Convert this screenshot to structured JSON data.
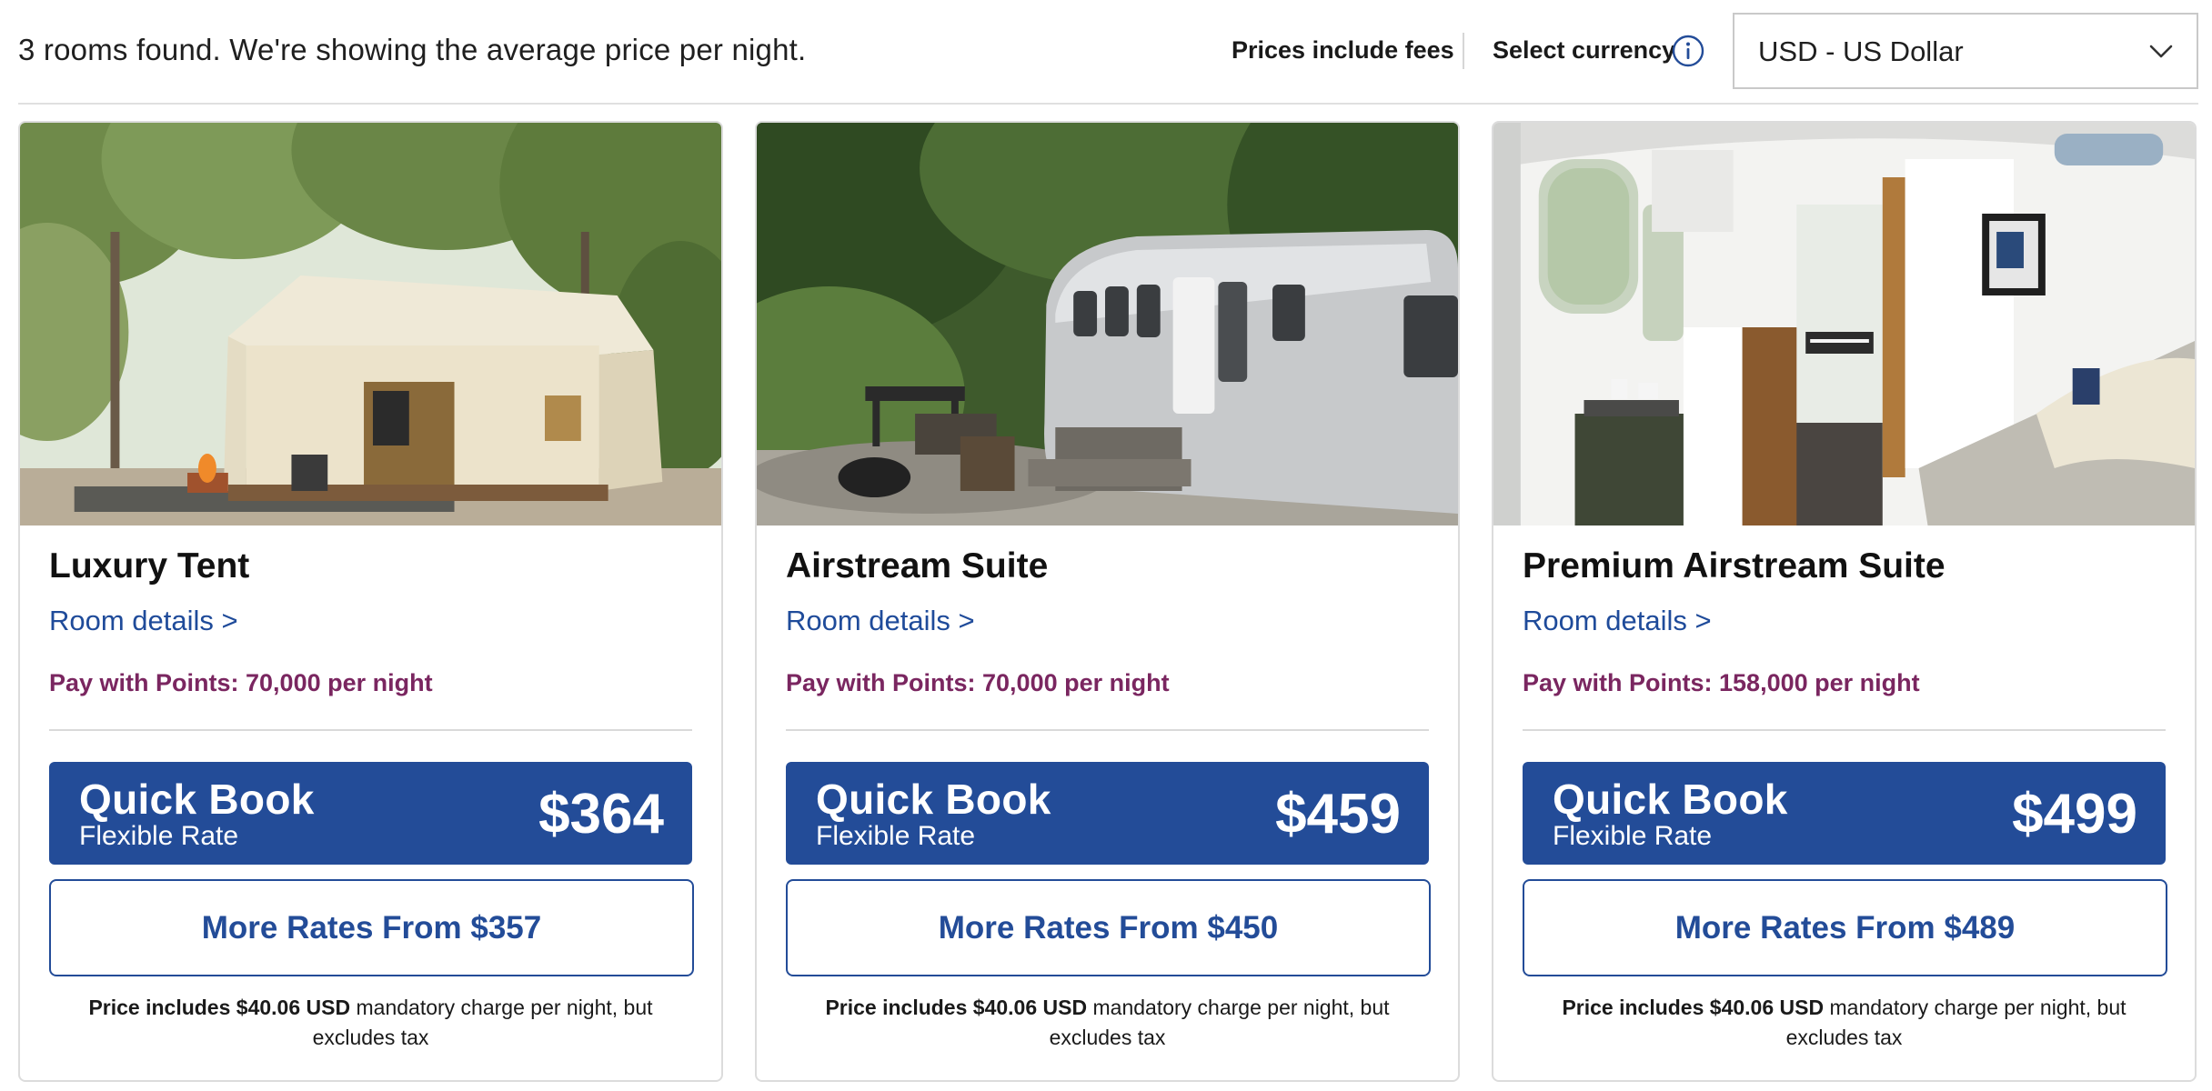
{
  "header": {
    "results_text": "3 rooms found. We're showing the average price per night.",
    "fees_label": "Prices include fees",
    "currency_label": "Select currency",
    "info_icon": "info-icon",
    "currency_value": "USD - US Dollar",
    "dropdown_icon": "chevron-down-icon"
  },
  "rooms": [
    {
      "title": "Luxury Tent",
      "details_link": "Room details >",
      "points": "Pay with Points: 70,000 per night",
      "quickbook_title": "Quick Book",
      "quickbook_sub": "Flexible Rate",
      "quickbook_price": "$364",
      "more_rates": "More Rates From $357",
      "note_prefix": "Price includes",
      "note_amount": "$40.06 USD",
      "note_suffix": "mandatory charge per night, but excludes tax"
    },
    {
      "title": "Airstream Suite",
      "details_link": "Room details >",
      "points": "Pay with Points: 70,000 per night",
      "quickbook_title": "Quick Book",
      "quickbook_sub": "Flexible Rate",
      "quickbook_price": "$459",
      "more_rates": "More Rates From $450",
      "note_prefix": "Price includes",
      "note_amount": "$40.06 USD",
      "note_suffix": "mandatory charge per night, but excludes tax"
    },
    {
      "title": "Premium Airstream Suite",
      "details_link": "Room details >",
      "points": "Pay with Points: 158,000 per night",
      "quickbook_title": "Quick Book",
      "quickbook_sub": "Flexible Rate",
      "quickbook_price": "$499",
      "more_rates": "More Rates From $489",
      "note_prefix": "Price includes",
      "note_amount": "$40.06 USD",
      "note_suffix": "mandatory charge per night, but excludes tax"
    }
  ],
  "colors": {
    "primary_blue": "#234c98",
    "link_blue": "#1f4b9a",
    "points_purple": "#7a2660"
  }
}
